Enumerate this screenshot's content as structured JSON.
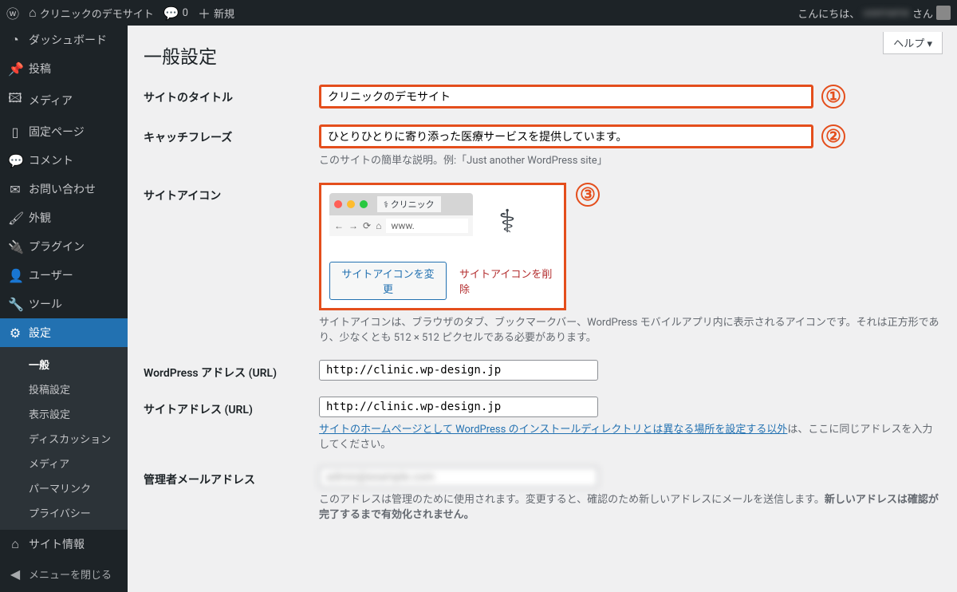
{
  "adminbar": {
    "site_name": "クリニックのデモサイト",
    "comments": "0",
    "new": "新規",
    "greeting": "こんにちは、",
    "san": "さん"
  },
  "help": "ヘルプ ▾",
  "sidebar": {
    "dashboard": "ダッシュボード",
    "posts": "投稿",
    "media": "メディア",
    "pages": "固定ページ",
    "comments": "コメント",
    "contact": "お問い合わせ",
    "appearance": "外観",
    "plugins": "プラグイン",
    "users": "ユーザー",
    "tools": "ツール",
    "settings": "設定",
    "sub": {
      "general": "一般",
      "writing": "投稿設定",
      "reading": "表示設定",
      "discussion": "ディスカッション",
      "media": "メディア",
      "permalinks": "パーマリンク",
      "privacy": "プライバシー"
    },
    "site_info": "サイト情報",
    "collapse": "メニューを閉じる"
  },
  "page": {
    "title": "一般設定",
    "rows": {
      "site_title": {
        "label": "サイトのタイトル",
        "value": "クリニックのデモサイト",
        "marker": "①"
      },
      "tagline": {
        "label": "キャッチフレーズ",
        "value": "ひとりひとりに寄り添った医療サービスを提供しています。",
        "desc": "このサイトの簡単な説明。例:「Just another WordPress site」",
        "marker": "②"
      },
      "site_icon": {
        "label": "サイトアイコン",
        "marker": "③",
        "tab_text": "クリニック",
        "url_text": "www.",
        "change_btn": "サイトアイコンを変更",
        "remove_link": "サイトアイコンを削除",
        "desc1": "サイトアイコンは、ブラウザのタブ、ブックマークバー、WordPress モバイルアプリ内に表示されるアイコンです。それは正方形であり、少なくとも ",
        "size": "512 × 512",
        "desc2": " ピクセルである必要があります。"
      },
      "wp_url": {
        "label": "WordPress アドレス (URL)",
        "value": "http://clinic.wp-design.jp"
      },
      "site_url": {
        "label": "サイトアドレス (URL)",
        "value": "http://clinic.wp-design.jp",
        "desc_link": "サイトのホームページとして WordPress のインストールディレクトリとは異なる場所を設定する以外",
        "desc_rest": "は、ここに同じアドレスを入力してください。"
      },
      "admin_email": {
        "label": "管理者メールアドレス",
        "value": "admin@example.com",
        "desc1": "このアドレスは管理のために使用されます。変更すると、確認のため新しいアドレスにメールを送信します。",
        "desc2": "新しいアドレスは確認が完了するまで有効化されません。"
      }
    }
  }
}
